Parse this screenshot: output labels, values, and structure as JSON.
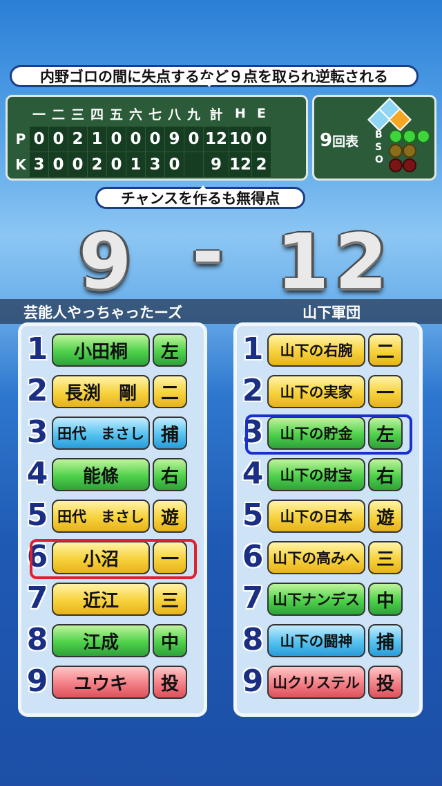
{
  "banner_top": "内野ゴロの間に失点するなど９点を取られ逆転される",
  "banner_mid": "チャンスを作るも無得点",
  "scoreboard": {
    "headers": [
      "一",
      "二",
      "三",
      "四",
      "五",
      "六",
      "七",
      "八",
      "九",
      "計",
      "H",
      "E"
    ],
    "rows": [
      {
        "team": "P",
        "cells": [
          "0",
          "0",
          "2",
          "1",
          "0",
          "0",
          "0",
          "9",
          "0",
          "12",
          "10",
          "0"
        ]
      },
      {
        "team": "K",
        "cells": [
          "3",
          "0",
          "0",
          "2",
          "0",
          "1",
          "3",
          "0",
          "",
          "9",
          "12",
          "2"
        ]
      }
    ]
  },
  "count": {
    "inning": "9",
    "half": "回表",
    "labels": [
      "B",
      "S",
      "O"
    ],
    "balls": 0,
    "strikes": 0,
    "outs": 0,
    "colors": {
      "ball": "#3fd43b",
      "strike": "#e8c12a",
      "out": "#e03030",
      "runner": "#f5a623"
    }
  },
  "score": {
    "left": "9",
    "dash": "-",
    "right": "12"
  },
  "teams": [
    {
      "name": "芸能人やっちゃったーズ",
      "lineup": [
        {
          "num": "1",
          "name": "小田桐",
          "pos": "左",
          "color": "green",
          "poscolor": "yellow"
        },
        {
          "num": "2",
          "name": "長渕　剛",
          "pos": "二",
          "color": "yellow",
          "poscolor": "yellow"
        },
        {
          "num": "3",
          "name": "田代　まさし",
          "pos": "捕",
          "color": "blue",
          "poscolor": "blue"
        },
        {
          "num": "4",
          "name": "能條",
          "pos": "右",
          "color": "green",
          "poscolor": "green"
        },
        {
          "num": "5",
          "name": "田代　まさし",
          "pos": "遊",
          "color": "yellow",
          "poscolor": "yellow"
        },
        {
          "num": "6",
          "name": "小沼",
          "pos": "一",
          "color": "yellow",
          "poscolor": "yellow"
        },
        {
          "num": "7",
          "name": "近江",
          "pos": "三",
          "color": "yellow",
          "poscolor": "yellow"
        },
        {
          "num": "8",
          "name": "江成",
          "pos": "中",
          "color": "green",
          "poscolor": "green"
        },
        {
          "num": "9",
          "name": "ユウキ",
          "pos": "投",
          "color": "red",
          "poscolor": "red"
        }
      ]
    },
    {
      "name": "山下軍団",
      "lineup": [
        {
          "num": "1",
          "name": "山下の右腕",
          "pos": "二",
          "color": "yellow",
          "poscolor": "yellow"
        },
        {
          "num": "2",
          "name": "山下の実家",
          "pos": "一",
          "color": "yellow",
          "poscolor": "yellow"
        },
        {
          "num": "3",
          "name": "山下の貯金",
          "pos": "左",
          "color": "green",
          "poscolor": "green"
        },
        {
          "num": "4",
          "name": "山下の財宝",
          "pos": "右",
          "color": "green",
          "poscolor": "green"
        },
        {
          "num": "5",
          "name": "山下の日本",
          "pos": "遊",
          "color": "yellow",
          "poscolor": "yellow"
        },
        {
          "num": "6",
          "name": "山下の高みへ",
          "pos": "三",
          "color": "yellow",
          "poscolor": "yellow"
        },
        {
          "num": "7",
          "name": "山下ナンデス",
          "pos": "中",
          "color": "green",
          "poscolor": "green"
        },
        {
          "num": "8",
          "name": "山下の闘神",
          "pos": "捕",
          "color": "blue",
          "poscolor": "blue"
        },
        {
          "num": "9",
          "name": "山クリステル",
          "pos": "投",
          "color": "red",
          "poscolor": "red"
        }
      ]
    }
  ],
  "highlights": {
    "left_row": 6,
    "left_color": "#e0202a",
    "right_row": 3,
    "right_color": "#1a2fd0"
  }
}
